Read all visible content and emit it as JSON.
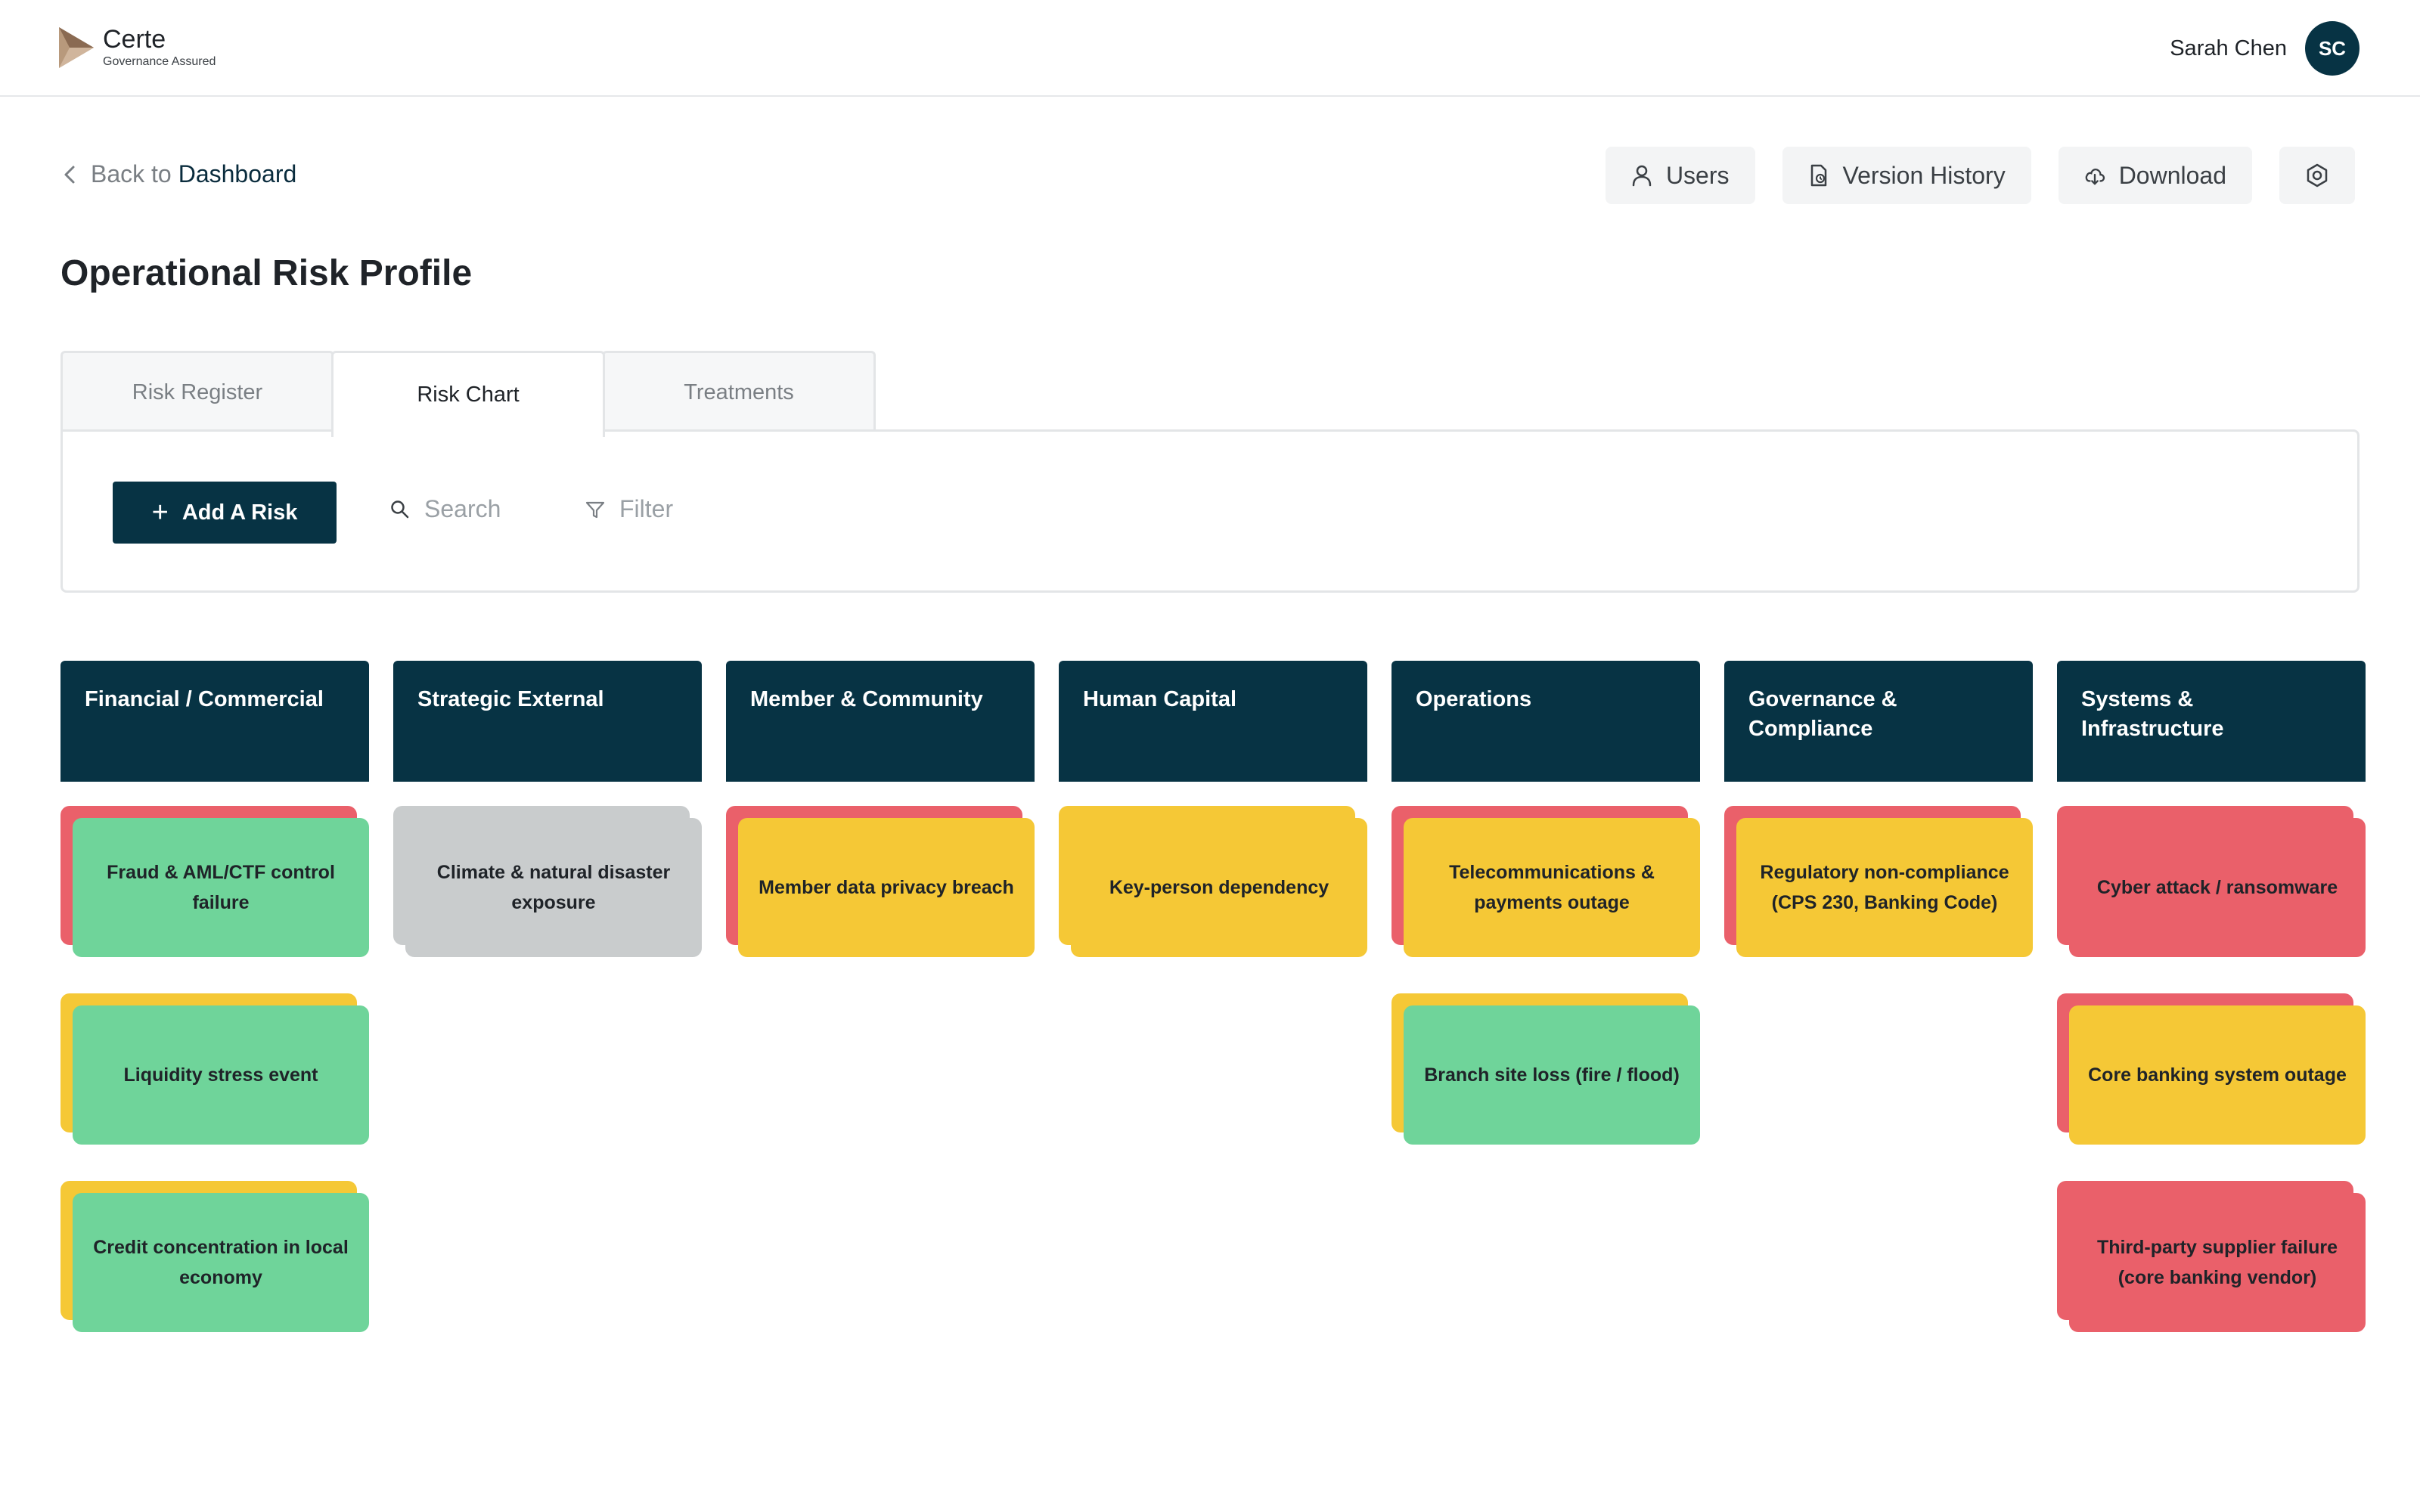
{
  "app": {
    "name": "Certe",
    "tagline": "Governance Assured",
    "user_name": "Sarah Chen",
    "user_initials": "SC"
  },
  "nav": {
    "back_prefix": "Back to",
    "back_link": "Dashboard"
  },
  "actions": {
    "users": "Users",
    "version_history": "Version History",
    "download": "Download",
    "settings_icon": "settings-hexagon-icon"
  },
  "page": {
    "title": "Operational Risk Profile"
  },
  "tabs": [
    {
      "label": "Risk Register",
      "active": false
    },
    {
      "label": "Risk Chart",
      "active": true
    },
    {
      "label": "Treatments",
      "active": false
    }
  ],
  "toolbar": {
    "add_label": "Add A Risk",
    "search_label": "Search",
    "filter_label": "Filter"
  },
  "colors": {
    "primary": "#073344",
    "red": "#ea606a",
    "green": "#6fd49a",
    "yellow": "#f5c836",
    "grey": "#c9cccd"
  },
  "board": {
    "columns": [
      {
        "title": "Financial / Commercial",
        "cards": [
          {
            "title": "Fraud & AML/CTF control failure",
            "inherent": "red",
            "residual": "green"
          },
          {
            "title": "Liquidity stress event",
            "inherent": "yellow",
            "residual": "green"
          },
          {
            "title": "Credit concentration in local economy",
            "inherent": "yellow",
            "residual": "green"
          }
        ]
      },
      {
        "title": "Strategic External",
        "cards": [
          {
            "title": "Climate & natural disaster exposure",
            "inherent": "grey",
            "residual": "grey"
          }
        ]
      },
      {
        "title": "Member & Community",
        "cards": [
          {
            "title": "Member data privacy breach",
            "inherent": "red",
            "residual": "yellow"
          }
        ]
      },
      {
        "title": "Human Capital",
        "cards": [
          {
            "title": "Key-person dependency",
            "inherent": "yellow",
            "residual": "yellow"
          }
        ]
      },
      {
        "title": "Operations",
        "cards": [
          {
            "title": "Telecommunications & payments outage",
            "inherent": "red",
            "residual": "yellow"
          },
          {
            "title": "Branch site loss (fire / flood)",
            "inherent": "yellow",
            "residual": "green"
          }
        ]
      },
      {
        "title": "Governance & Compliance",
        "cards": [
          {
            "title": "Regulatory non-compliance (CPS 230, Banking Code)",
            "inherent": "red",
            "residual": "yellow"
          }
        ]
      },
      {
        "title": "Systems & Infrastructure",
        "cards": [
          {
            "title": "Cyber attack / ransomware",
            "inherent": "red",
            "residual": "red"
          },
          {
            "title": "Core banking system outage",
            "inherent": "red",
            "residual": "yellow"
          },
          {
            "title": "Third-party supplier failure (core banking vendor)",
            "inherent": "red",
            "residual": "red"
          }
        ]
      }
    ]
  }
}
